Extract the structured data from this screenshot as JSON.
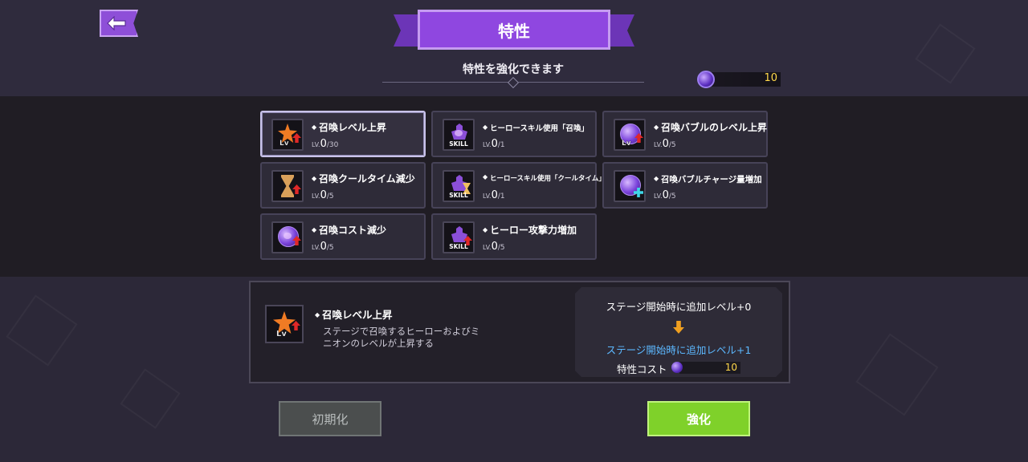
{
  "header": {
    "title": "特性",
    "subtitle": "特性を強化できます"
  },
  "currency": {
    "icon": "gem-icon",
    "value": "10",
    "color": "#ffd84a"
  },
  "traits": [
    {
      "name": "召喚レベル上昇",
      "lv_label": "LV.",
      "lv": "0",
      "max": "/30",
      "icon": "summon-level-icon"
    },
    {
      "name": "ヒーロースキル使用「召喚」",
      "lv_label": "LV.",
      "lv": "0",
      "max": "/1",
      "icon": "hero-skill-summon-icon"
    },
    {
      "name": "召喚バブルのレベル上昇",
      "lv_label": "LV.",
      "lv": "0",
      "max": "/5",
      "icon": "bubble-level-icon"
    },
    {
      "name": "召喚クールタイム減少",
      "lv_label": "LV.",
      "lv": "0",
      "max": "/5",
      "icon": "cooltime-icon"
    },
    {
      "name": "ヒーロースキル使用「クールタイム」",
      "lv_label": "LV.",
      "lv": "0",
      "max": "/1",
      "icon": "hero-skill-cooltime-icon"
    },
    {
      "name": "召喚バブルチャージ量増加",
      "lv_label": "LV.",
      "lv": "0",
      "max": "/5",
      "icon": "bubble-charge-icon"
    },
    {
      "name": "召喚コスト減少",
      "lv_label": "LV.",
      "lv": "0",
      "max": "/5",
      "icon": "summon-cost-icon"
    },
    {
      "name": "ヒーロー攻撃力増加",
      "lv_label": "LV.",
      "lv": "0",
      "max": "/5",
      "icon": "hero-attack-icon"
    }
  ],
  "icon_tags": {
    "lv": "Lv",
    "skill": "SKILL"
  },
  "detail": {
    "name": "召喚レベル上昇",
    "description": "ステージで召喚するヒーローおよびミニオンのレベルが上昇する",
    "current": "ステージ開始時に追加レベル+0",
    "next": "ステージ開始時に追加レベル+1",
    "cost_label": "特性コスト",
    "cost_value": "10",
    "next_color": "#5cb8ff"
  },
  "buttons": {
    "reset": "初期化",
    "enhance": "強化"
  },
  "colors": {
    "accent": "#8f47e0",
    "enhance": "#7fd12a"
  }
}
